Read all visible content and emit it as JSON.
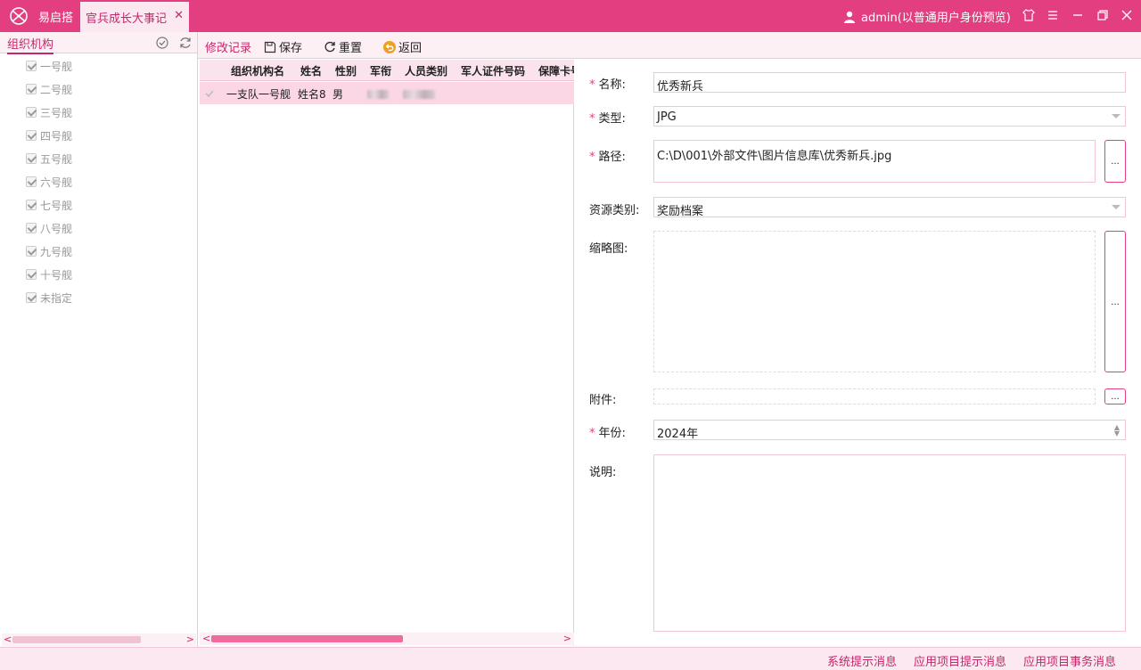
{
  "titlebar": {
    "app_name": "易启搭",
    "tab_label": "官兵成长大事记",
    "user_text": "admin(以普通用户身份预览)"
  },
  "left_panel": {
    "title": "组织机构",
    "items": [
      "一号舰",
      "二号舰",
      "三号舰",
      "四号舰",
      "五号舰",
      "六号舰",
      "七号舰",
      "八号舰",
      "九号舰",
      "十号舰",
      "未指定"
    ]
  },
  "toolbar": {
    "edit_log": "修改记录",
    "save": "保存",
    "reset": "重置",
    "back": "返回"
  },
  "grid": {
    "headers": [
      "组织机构名",
      "姓名",
      "性别",
      "军衔",
      "人员类别",
      "军人证件号码",
      "保障卡号"
    ],
    "rows": [
      {
        "org": "一支队一号舰",
        "name": "姓名8",
        "gender": "男"
      }
    ]
  },
  "form": {
    "name_label": "名称:",
    "name_value": "优秀新兵",
    "type_label": "类型:",
    "type_value": "JPG",
    "path_label": "路径:",
    "path_value": "C:\\D\\001\\外部文件\\图片信息库\\优秀新兵.jpg",
    "resource_label": "资源类别:",
    "resource_value": "奖励档案",
    "thumb_label": "缩略图:",
    "attach_label": "附件:",
    "year_label": "年份:",
    "year_value": "2024年",
    "desc_label": "说明:",
    "ellipsis": "..."
  },
  "statusbar": {
    "system_msg": "系统提示消息",
    "app_msg": "应用项目提示消息",
    "app_task": "应用项目事务消息"
  },
  "colors": {
    "brand": "#e33f80",
    "accent_text": "#c5276a",
    "panel_bg": "#fdf0f5",
    "selected_row": "#fbd6e4"
  }
}
